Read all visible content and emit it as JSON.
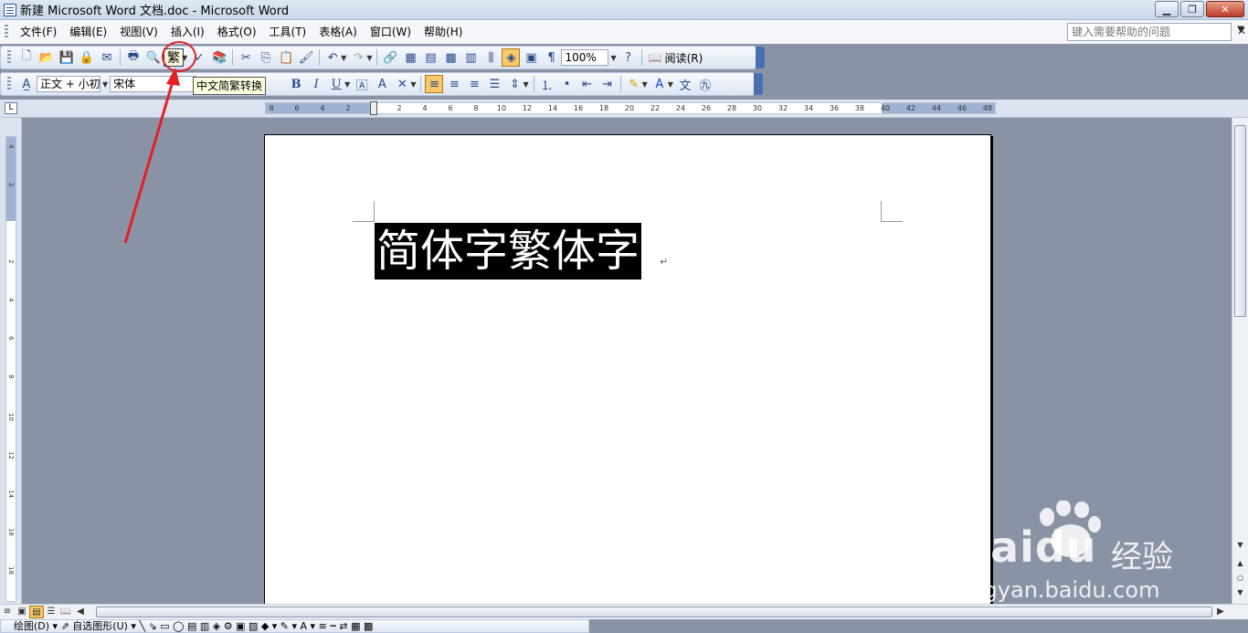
{
  "window": {
    "title": "新建 Microsoft Word 文档.doc - Microsoft Word",
    "minimize": "▁",
    "restore": "❐",
    "close": "✕"
  },
  "menu": {
    "items": [
      "文件(F)",
      "编辑(E)",
      "视图(V)",
      "插入(I)",
      "格式(O)",
      "工具(T)",
      "表格(A)",
      "窗口(W)",
      "帮助(H)"
    ],
    "help_placeholder": "键入需要帮助的问题",
    "close_glyph": "✕"
  },
  "toolbar_standard": {
    "fan_button": "繁",
    "zoom": "100%",
    "read_button": "阅读(R)"
  },
  "toolbar_format": {
    "style": "正文 + 小初",
    "font": "宋体",
    "bold": "B",
    "italic": "I",
    "underline": "U"
  },
  "tooltip": "中文简繁转换",
  "ruler": {
    "h_ticks": [
      "8",
      "6",
      "4",
      "2",
      "2",
      "4",
      "6",
      "8",
      "10",
      "12",
      "14",
      "16",
      "18",
      "20",
      "22",
      "24",
      "26",
      "28",
      "30",
      "32",
      "34",
      "36",
      "38",
      "40",
      "42",
      "44",
      "46",
      "48"
    ],
    "v_ticks": [
      "4",
      "2",
      "2",
      "4",
      "6",
      "8",
      "10",
      "12",
      "14",
      "16",
      "18"
    ],
    "corner": "L"
  },
  "document": {
    "selected_text": "简体字繁体字",
    "para_mark": "↵"
  },
  "drawing_bar": "绘图(D) ▾  ⇗  自选图形(U) ▾  ╲  ⇘  ▭  ◯  ▤  ▥  ◈  ⚙  ▣  ▧  ◆ ▾  ✎ ▾  A ▾  ≡  ┅  ⇄  ▦  ▩",
  "watermark": {
    "brand": "Baidu",
    "product": "经验",
    "url": "jingyan.baidu.com"
  },
  "colors": {
    "annotation": "#e41f26",
    "toolbar_accent": "#4a6fb0",
    "selection": "#000000"
  }
}
